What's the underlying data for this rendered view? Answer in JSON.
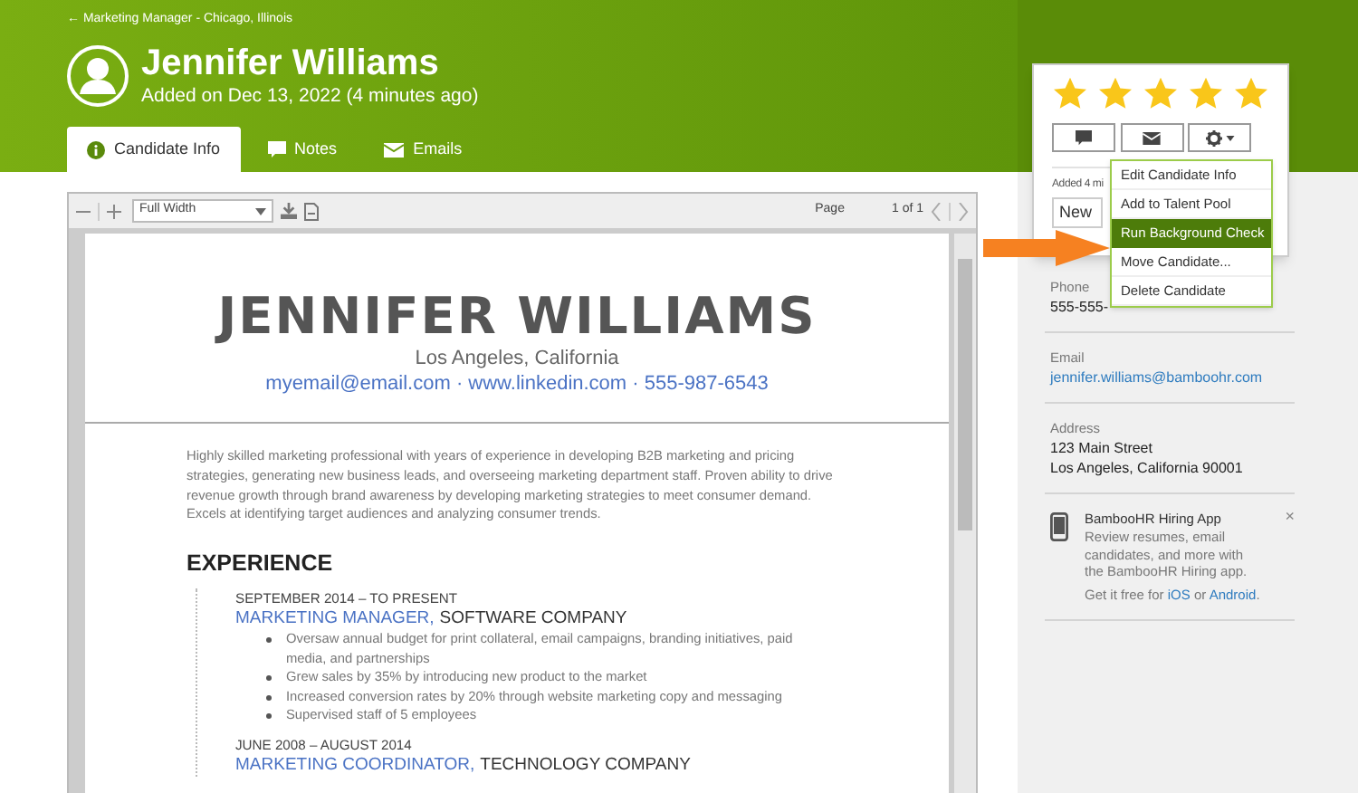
{
  "breadcrumb": "← Marketing Manager - Chicago, Illinois",
  "candidate": {
    "name": "Jennifer Williams",
    "added": "Added on Dec 13, 2022 (4 minutes ago)"
  },
  "tabs": [
    {
      "label": "Candidate Info",
      "selected": true
    },
    {
      "label": "Notes",
      "selected": false
    },
    {
      "label": "Emails",
      "selected": false
    }
  ],
  "viewer": {
    "zoom": "Full Width",
    "page_label": "Page",
    "page_count": "1 of 1"
  },
  "resume": {
    "name": "JENNIFER WILLIAMS",
    "location": "Los Angeles, California",
    "contact": "myemail@email.com · www.linkedin.com · 555-987-6543",
    "summary": "Highly skilled marketing professional with years of experience in developing B2B marketing and pricing strategies, generating new business leads, and overseeing marketing department staff. Proven ability to drive revenue growth through brand awareness by developing marketing strategies to meet consumer demand. Excels at identifying target audiences and analyzing consumer trends.",
    "section": "EXPERIENCE",
    "jobs": [
      {
        "dates": "SEPTEMBER 2014 – TO PRESENT",
        "title": "MARKETING MANAGER,",
        "company": "SOFTWARE COMPANY",
        "bullets": [
          "Oversaw annual budget for print collateral, email campaigns, branding initiatives, paid media, and partnerships",
          "Grew sales by 35% by introducing new product to the market",
          "Increased conversion rates by 20% through website marketing copy and messaging",
          "Supervised staff of 5 employees"
        ]
      },
      {
        "dates": "JUNE 2008 – AUGUST 2014",
        "title": "MARKETING COORDINATOR,",
        "company": "TECHNOLOGY COMPANY"
      }
    ]
  },
  "card": {
    "stars": 5,
    "added": "Added 4 mi",
    "status": "New"
  },
  "menu": [
    {
      "label": "Edit Candidate Info",
      "selected": false
    },
    {
      "label": "Add to Talent Pool",
      "selected": false
    },
    {
      "label": "Run Background Check",
      "selected": true
    },
    {
      "label": "Move Candidate...",
      "selected": false
    },
    {
      "label": "Delete Candidate",
      "selected": false
    }
  ],
  "details": [
    {
      "label": "Phone",
      "kind": "text",
      "lines": [
        "555-555-"
      ]
    },
    {
      "label": "Email",
      "kind": "link",
      "lines": [
        "jennifer.williams@bamboohr.com"
      ]
    },
    {
      "label": "Address",
      "kind": "text",
      "lines": [
        "123 Main Street",
        "Los Angeles, California 90001"
      ]
    }
  ],
  "promo": {
    "title": "BambooHR Hiring App",
    "close": "×",
    "body": "Review resumes, email candidates, and more with the BambooHR Hiring app.",
    "cta": [
      {
        "text": "Get it free for",
        "link": false
      },
      {
        "text": "iOS",
        "link": true
      },
      {
        "text": "or",
        "link": false
      },
      {
        "text": "Android",
        "link": true
      },
      {
        "text": ".",
        "link": false
      }
    ]
  }
}
